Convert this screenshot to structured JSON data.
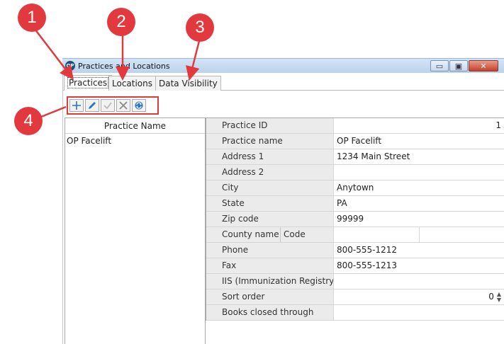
{
  "window": {
    "icon_text": "OP",
    "title": "Practices and Locations",
    "minimize_glyph": "▭",
    "restore_glyph": "▣",
    "close_glyph": "✕"
  },
  "tabs": [
    {
      "label": "Practices",
      "active": true
    },
    {
      "label": "Locations",
      "active": false
    },
    {
      "label": "Data Visibility",
      "active": false
    }
  ],
  "toolbar": {
    "buttons": [
      {
        "icon": "add-icon",
        "enabled": true,
        "color": "#2b73c4"
      },
      {
        "icon": "edit-icon",
        "enabled": true,
        "color": "#2b73c4"
      },
      {
        "icon": "save-check-icon",
        "enabled": false,
        "color": "#b9b9b9"
      },
      {
        "icon": "cancel-x-icon",
        "enabled": false,
        "color": "#8a8a8a"
      },
      {
        "icon": "refresh-icon",
        "enabled": true,
        "color": "#2b73c4"
      }
    ]
  },
  "practice_list": {
    "header": "Practice Name",
    "rows": [
      "OP Facelift"
    ]
  },
  "details": {
    "practice_id_label": "Practice ID",
    "practice_id_value": "1",
    "practice_name_label": "Practice name",
    "practice_name_value": "OP Facelift",
    "address1_label": "Address 1",
    "address1_value": "1234 Main Street",
    "address2_label": "Address 2",
    "address2_value": "",
    "city_label": "City",
    "city_value": "Anytown",
    "state_label": "State",
    "state_value": "PA",
    "zip_label": "Zip code",
    "zip_value": "99999",
    "county_name_label": "County name",
    "county_code_label": "Code",
    "county_name_value": "",
    "county_code_value": "",
    "phone_label": "Phone",
    "phone_value": "800-555-1212",
    "fax_label": "Fax",
    "fax_value": "800-555-1213",
    "iis_label": "IIS (Immunization Registry)",
    "iis_value": "",
    "sort_order_label": "Sort order",
    "sort_order_value": "0",
    "books_closed_label": "Books closed through",
    "books_closed_value": ""
  },
  "callouts": [
    "1",
    "2",
    "3",
    "4"
  ],
  "colors": {
    "callout": "#e2393f",
    "accent_blue": "#2b73c4",
    "label_bg": "#ebebeb"
  }
}
